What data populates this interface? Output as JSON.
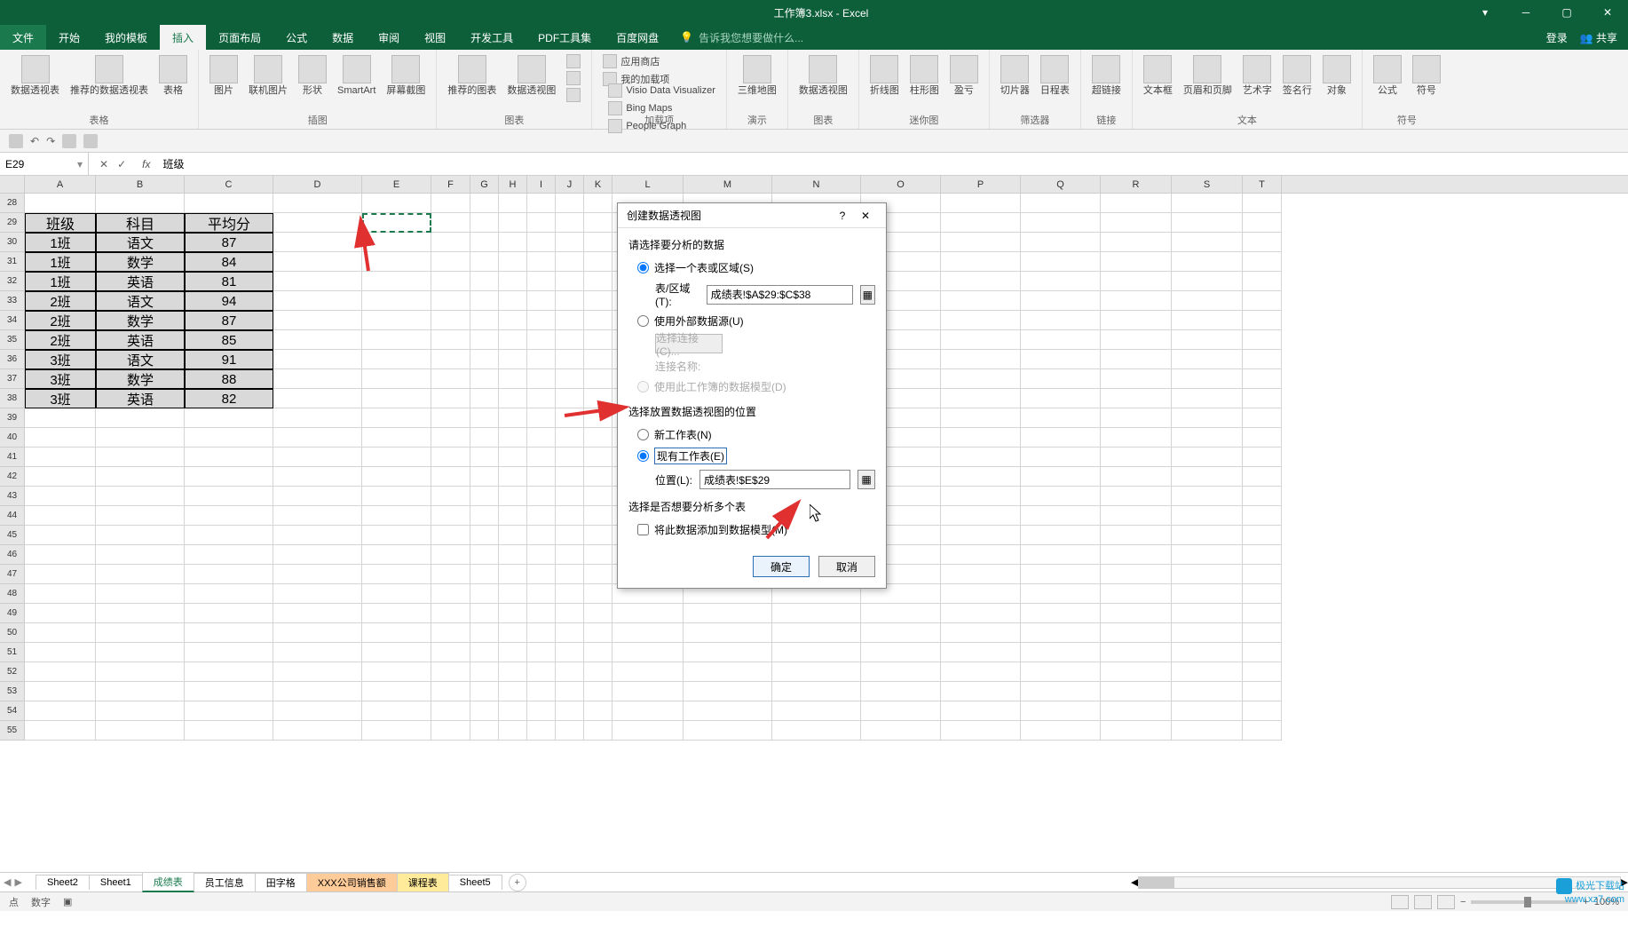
{
  "window": {
    "title": "工作簿3.xlsx - Excel",
    "login": "登录",
    "share": "共享"
  },
  "tabs": [
    "文件",
    "开始",
    "我的模板",
    "插入",
    "页面布局",
    "公式",
    "数据",
    "审阅",
    "视图",
    "开发工具",
    "PDF工具集",
    "百度网盘"
  ],
  "tellme": "告诉我您想要做什么...",
  "ribbon": {
    "groups": [
      {
        "label": "表格",
        "items": [
          "数据透视表",
          "推荐的数据透视表",
          "表格"
        ]
      },
      {
        "label": "插图",
        "items": [
          "图片",
          "联机图片",
          "形状",
          "SmartArt",
          "屏幕截图"
        ]
      },
      {
        "label": "",
        "items": [
          "推荐的图表"
        ]
      },
      {
        "label": "图表",
        "items": [
          "数据透视图"
        ]
      },
      {
        "label": "加载项",
        "small": [
          "应用商店",
          "我的加载项",
          "Visio Data Visualizer",
          "Bing Maps",
          "People Graph"
        ]
      },
      {
        "label": "演示",
        "items": [
          "三维地图"
        ]
      },
      {
        "label": "迷你图",
        "items": [
          "折线图",
          "柱形图",
          "盈亏"
        ]
      },
      {
        "label": "筛选器",
        "items": [
          "切片器",
          "日程表"
        ]
      },
      {
        "label": "链接",
        "items": [
          "超链接"
        ]
      },
      {
        "label": "文本",
        "items": [
          "文本框",
          "页眉和页脚",
          "艺术字",
          "签名行",
          "对象"
        ]
      },
      {
        "label": "符号",
        "items": [
          "公式",
          "符号"
        ]
      }
    ]
  },
  "formulaBar": {
    "nameBox": "E29",
    "formula": "班级"
  },
  "columns": [
    "A",
    "B",
    "C",
    "D",
    "E",
    "F",
    "G",
    "H",
    "I",
    "J",
    "K",
    "L",
    "M",
    "N",
    "O",
    "P",
    "Q",
    "R",
    "S",
    "T"
  ],
  "rowStart": 28,
  "rowEnd": 55,
  "table": {
    "headers": [
      "班级",
      "科目",
      "平均分"
    ],
    "rows": [
      [
        "1班",
        "语文",
        "87"
      ],
      [
        "1班",
        "数学",
        "84"
      ],
      [
        "1班",
        "英语",
        "81"
      ],
      [
        "2班",
        "语文",
        "94"
      ],
      [
        "2班",
        "数学",
        "87"
      ],
      [
        "2班",
        "英语",
        "85"
      ],
      [
        "3班",
        "语文",
        "91"
      ],
      [
        "3班",
        "数学",
        "88"
      ],
      [
        "3班",
        "英语",
        "82"
      ]
    ]
  },
  "dialog": {
    "title": "创建数据透视图",
    "sec1": "请选择要分析的数据",
    "opt1": "选择一个表或区域(S)",
    "rangeLabel": "表/区域(T):",
    "rangeValue": "成绩表!$A$29:$C$38",
    "opt2": "使用外部数据源(U)",
    "chooseConn": "选择连接(C)...",
    "connName": "连接名称:",
    "opt3": "使用此工作簿的数据模型(D)",
    "sec2": "选择放置数据透视图的位置",
    "opt4": "新工作表(N)",
    "opt5": "现有工作表(E)",
    "locLabel": "位置(L):",
    "locValue": "成绩表!$E$29",
    "sec3": "选择是否想要分析多个表",
    "chk": "将此数据添加到数据模型(M)",
    "ok": "确定",
    "cancel": "取消"
  },
  "sheets": [
    "Sheet2",
    "Sheet1",
    "成绩表",
    "员工信息",
    "田字格",
    "XXX公司销售额",
    "课程表",
    "Sheet5"
  ],
  "activeSheet": "成绩表",
  "status": {
    "mode": "点",
    "mode2": "数字",
    "zoom": "100%",
    "ready": ""
  },
  "watermark": {
    "name": "极光下载站",
    "url": "www.xz7.com"
  }
}
